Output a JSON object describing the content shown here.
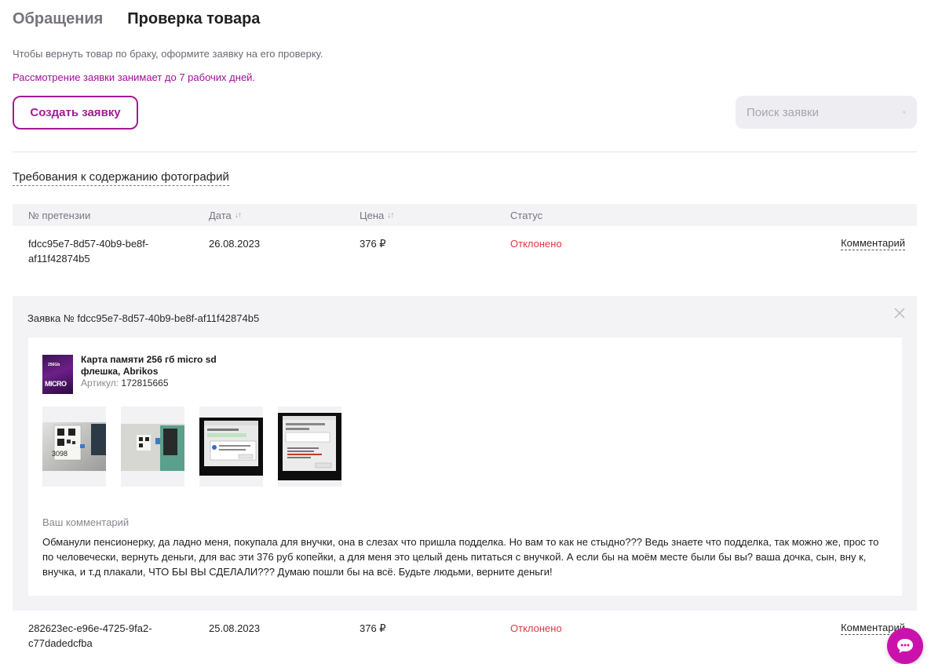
{
  "tabs": [
    {
      "label": "Обращения",
      "active": false
    },
    {
      "label": "Проверка товара",
      "active": true
    }
  ],
  "hint_return": "Чтобы вернуть товар по браку, оформите заявку на его проверку.",
  "hint_period": "Рассмотрение заявки занимает до 7 рабочих дней.",
  "create_button": "Создать заявку",
  "search": {
    "placeholder": "Поиск заявки",
    "icon": "search-icon"
  },
  "photo_requirements_link": "Требования к содержанию фотографий",
  "table": {
    "headers": {
      "number": "№ претензии",
      "date": "Дата",
      "price": "Цена",
      "status": "Статус"
    },
    "sort_glyph": "↓↑",
    "rows": [
      {
        "number": "fdcc95e7-8d57-40b9-be8f-af11f42874b5",
        "date": "26.08.2023",
        "price": "376 ₽",
        "status": "Отклонено",
        "action": "Комментарий"
      },
      {
        "number": "282623ec-e96e-4725-9fa2-c77dadedcfba",
        "date": "25.08.2023",
        "price": "376 ₽",
        "status": "Отклонено",
        "action": "Комментарий"
      }
    ]
  },
  "details": {
    "title": "Заявка № fdcc95e7-8d57-40b9-be8f-af11f42874b5",
    "product": {
      "name": "Карта памяти 256 гб micro sd флешка, Abrikos",
      "article_label": "Артикул:",
      "article": "172815665",
      "thumb_text_top": "256Gb",
      "thumb_text_bottom": "MICRO"
    },
    "photos": [
      {
        "description": "photo-1",
        "label": "3098"
      },
      {
        "description": "photo-2"
      },
      {
        "description": "screenshot-1"
      },
      {
        "description": "screenshot-2"
      }
    ],
    "comment_label": "Ваш комментарий",
    "comment_text": "Обманули пенсионерку, да ладно меня, покупала для внучки, она в слезах что пришла подделка. Но вам то как не стыдно??? Ведь знаете что подделка, так можно же, прос то по человечески, вернуть деньги, для вас эти 376 руб копейки, а для меня это целый день питаться с внучкой. А если бы на моём месте были бы вы? ваша дочка, сын, вну к, внучка, и т.д плакали, ЧТО БЫ ВЫ СДЕЛАЛИ??? Думаю пошли бы на всё. Будьте людьми, верните деньги!"
  },
  "colors": {
    "accent": "#a31a95",
    "status_rejected": "#e0393e",
    "chat": "#cb11ab"
  },
  "chat_button": {
    "icon": "chat-bubble-icon"
  }
}
